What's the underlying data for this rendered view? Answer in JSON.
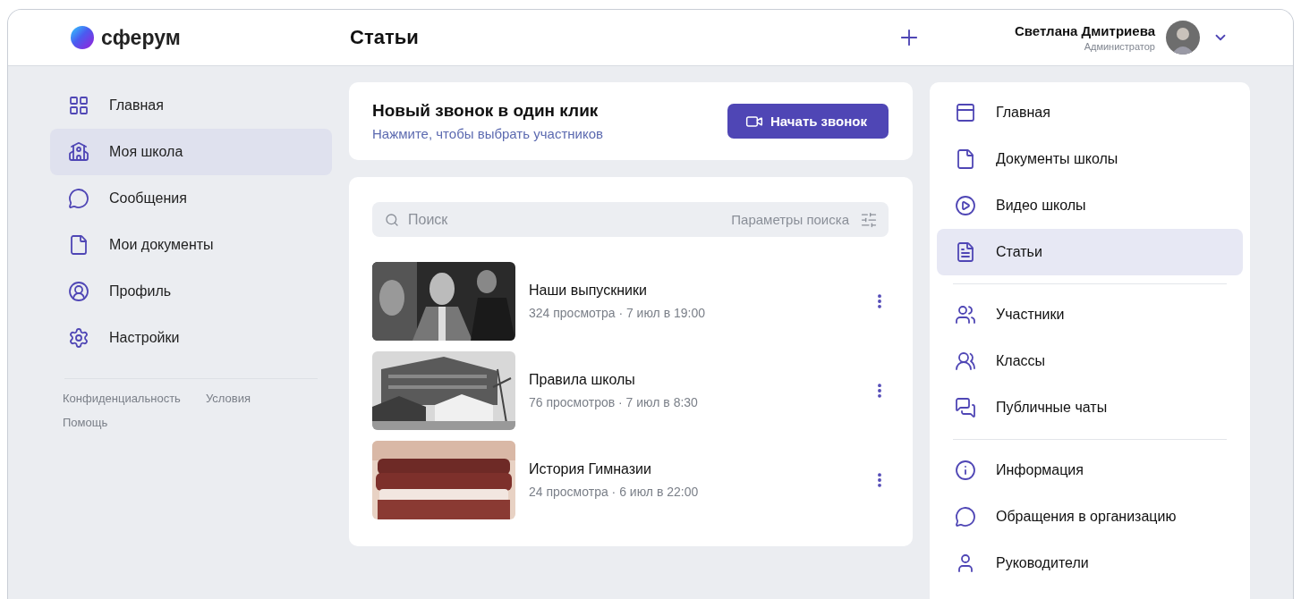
{
  "header": {
    "logo": "сферум",
    "title": "Статьи",
    "user": {
      "name": "Светлана Дмитриева",
      "role": "Администратор"
    }
  },
  "sidebar": {
    "items": [
      {
        "label": "Главная",
        "selected": false
      },
      {
        "label": "Моя школа",
        "selected": true
      },
      {
        "label": "Сообщения",
        "selected": false
      },
      {
        "label": "Мои документы",
        "selected": false
      },
      {
        "label": "Профиль",
        "selected": false
      },
      {
        "label": "Настройки",
        "selected": false
      }
    ],
    "footer_links": [
      "Конфиденциальность",
      "Условия",
      "Помощь"
    ]
  },
  "call_card": {
    "title": "Новый звонок в один клик",
    "subtitle": "Нажмите, чтобы выбрать участников",
    "button": "Начать звонок"
  },
  "articles": {
    "search": {
      "placeholder": "Поиск",
      "filters": "Параметры поиска"
    },
    "items": [
      {
        "title": "Наши выпускники",
        "meta": "324 просмотра · 7 июл в 19:00",
        "kind": "picture"
      },
      {
        "title": "Правила школы",
        "meta": "76 просмотров · 7 июл в 8:30",
        "kind": "picture"
      },
      {
        "title": "История Гимназии",
        "meta": "24 просмотра · 6 июл в 22:00",
        "kind": "picture"
      }
    ]
  },
  "school_nav": {
    "groups": [
      {
        "items": [
          {
            "label": "Главная",
            "selected": false
          },
          {
            "label": "Документы школы",
            "selected": false
          },
          {
            "label": "Видео школы",
            "selected": false
          },
          {
            "label": "Статьи",
            "selected": true
          }
        ]
      },
      {
        "items": [
          {
            "label": "Участники",
            "selected": false
          },
          {
            "label": "Классы",
            "selected": false
          },
          {
            "label": "Публичные чаты",
            "selected": false
          }
        ]
      },
      {
        "items": [
          {
            "label": "Информация",
            "selected": false
          },
          {
            "label": "Обращения в организацию",
            "selected": false
          },
          {
            "label": "Руководители",
            "selected": false
          }
        ]
      }
    ]
  }
}
